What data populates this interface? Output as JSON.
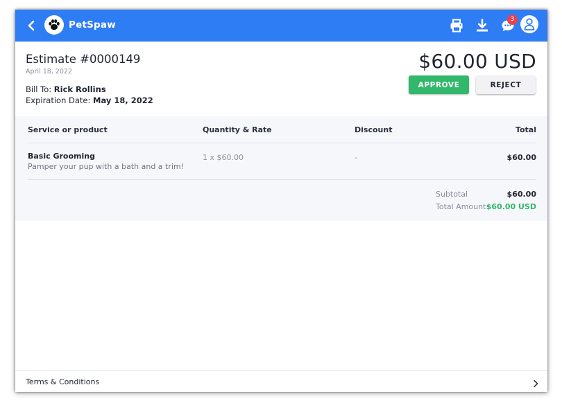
{
  "colors": {
    "topbar": "#2f7df4",
    "approve": "#31b86b",
    "badge": "#e8424b",
    "total_amount": "#31b86b"
  },
  "topbar": {
    "brand": "PetSpaw",
    "icons": [
      "back-chevron-icon",
      "paw-logo-icon",
      "print-icon",
      "download-icon",
      "chat-icon",
      "user-icon"
    ],
    "notification_count": "3"
  },
  "estimate": {
    "title": "Estimate #0000149",
    "date": "April 18, 2022",
    "bill_to_label": "Bill To:",
    "bill_to_name": "Rick Rollins",
    "expiration_label": "Expiration Date:",
    "expiration_date": "May 18, 2022",
    "total": "$60.00 USD",
    "approve_label": "APPROVE",
    "reject_label": "REJECT"
  },
  "table": {
    "headers": [
      "Service or product",
      "Quantity & Rate",
      "Discount",
      "Total"
    ],
    "rows": [
      {
        "name": "Basic Grooming",
        "description": "Pamper your pup with a bath and a trim!",
        "quantity_rate": "1 x $60.00",
        "discount": "-",
        "total": "$60.00"
      }
    ]
  },
  "summary": {
    "subtotal_label": "Subtotal",
    "subtotal_value": "$60.00",
    "total_label": "Total Amount",
    "total_value": "$60.00 USD"
  },
  "footer": {
    "label": "Terms & Conditions"
  }
}
